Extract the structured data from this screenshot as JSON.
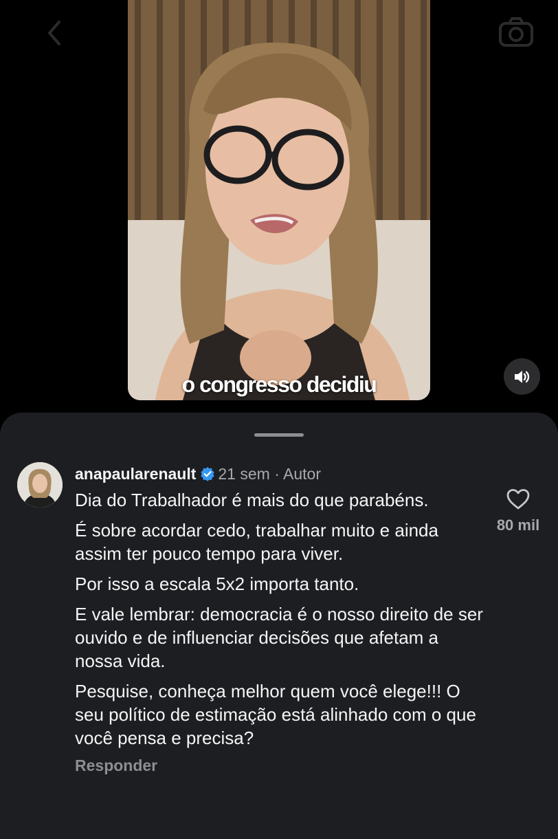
{
  "video": {
    "caption": "o congresso decidiu"
  },
  "controls": {
    "back_icon": "chevron-left-icon",
    "camera_icon": "camera-icon",
    "sound_icon": "speaker-icon"
  },
  "comment": {
    "username": "anapaularenault",
    "verified": true,
    "time": "21 sem",
    "separator": "·",
    "author_label": "Autor",
    "paragraphs": [
      "Dia do Trabalhador é mais do que parabéns.",
      "É sobre acordar cedo, trabalhar muito e ainda assim ter pouco tempo para viver.",
      "Por isso a escala 5x2 importa tanto.",
      "E vale lembrar: democracia é o nosso direito de ser ouvido e de influenciar decisões que afetam a nossa vida.",
      "Pesquise, conheça melhor quem você elege!!! O seu político de estimação está alinhado com o que você pensa e precisa?"
    ],
    "reply_label": "Responder",
    "like_count": "80 mil"
  },
  "colors": {
    "background": "#000000",
    "sheet": "#1c1e22",
    "verified_blue": "#3897f0",
    "secondary_text": "#a8a8ad"
  }
}
